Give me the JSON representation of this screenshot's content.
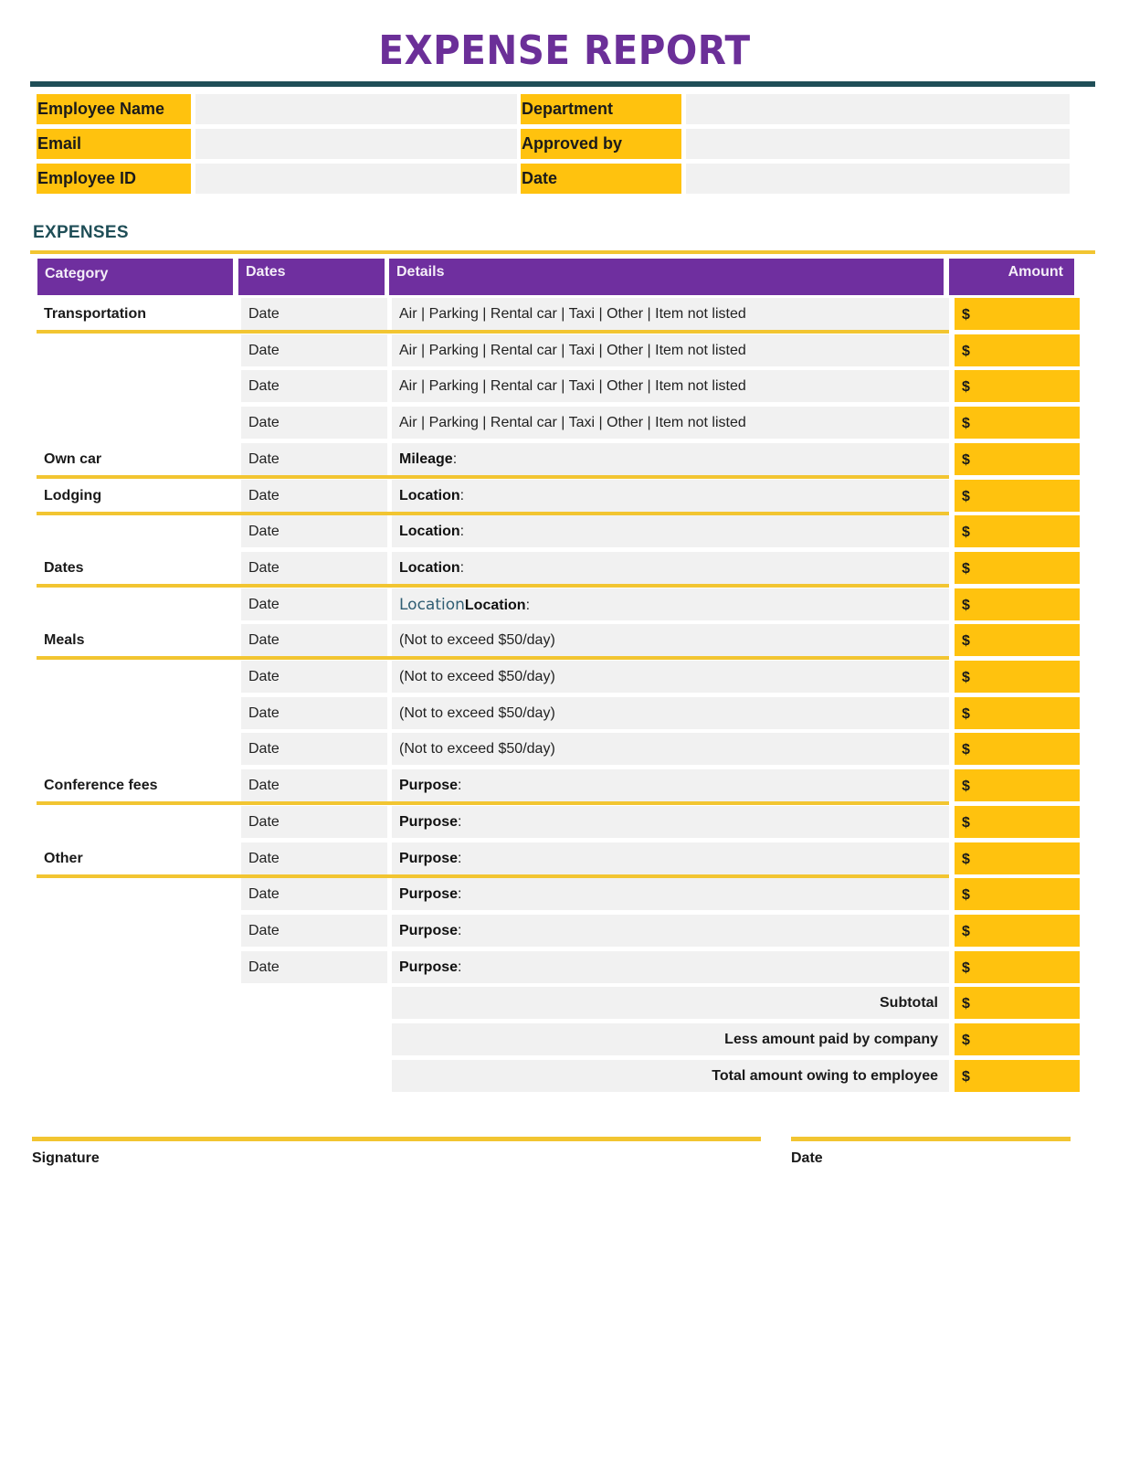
{
  "title": "EXPENSE REPORT",
  "info": {
    "left": [
      {
        "label": "Employee Name",
        "value": ""
      },
      {
        "label": "Email",
        "value": ""
      },
      {
        "label": "Employee ID",
        "value": ""
      }
    ],
    "right": [
      {
        "label": "Department",
        "value": ""
      },
      {
        "label": "Approved by",
        "value": ""
      },
      {
        "label": "Date",
        "value": ""
      }
    ]
  },
  "expenses": {
    "section_title": "EXPENSES",
    "headers": {
      "category": "Category",
      "dates": "Dates",
      "details": "Details",
      "amount": "Amount"
    },
    "currency_symbol": "$",
    "rows": [
      {
        "category": "Transportation",
        "date": "Date",
        "detail": "Air | Parking | Rental car | Taxi | Other | Item not listed",
        "detail_bold": "",
        "amount": ""
      },
      {
        "category": "",
        "date": "Date",
        "detail": "Air | Parking | Rental car | Taxi | Other | Item not listed",
        "detail_bold": "",
        "amount": ""
      },
      {
        "category": "",
        "date": "Date",
        "detail": "Air | Parking | Rental car | Taxi | Other | Item not listed",
        "detail_bold": "",
        "amount": ""
      },
      {
        "category": "",
        "date": "Date",
        "detail": "Air | Parking | Rental car | Taxi | Other | Item not listed",
        "detail_bold": "",
        "amount": ""
      },
      {
        "category": "Own car",
        "date": "Date",
        "detail_bold": "Mileage",
        "detail": ":",
        "amount": ""
      },
      {
        "category": "Lodging",
        "date": "Date",
        "detail_bold": "Location",
        "detail": ":",
        "amount": ""
      },
      {
        "category": "",
        "date": "Date",
        "detail_bold": "Location",
        "detail": ":",
        "amount": ""
      },
      {
        "category": "Dates",
        "date": "Date",
        "detail_bold": "Location",
        "detail": ":",
        "amount": ""
      },
      {
        "category": "",
        "date": "Date",
        "detail_prefix": "Location",
        "detail_bold": "Location",
        "detail": ":",
        "amount": ""
      },
      {
        "category": "Meals",
        "date": "Date",
        "detail": "(Not to exceed $50/day)",
        "detail_bold": "",
        "amount": ""
      },
      {
        "category": "",
        "date": "Date",
        "detail": "(Not to exceed $50/day)",
        "detail_bold": "",
        "amount": ""
      },
      {
        "category": "",
        "date": "Date",
        "detail": "(Not to exceed $50/day)",
        "detail_bold": "",
        "amount": ""
      },
      {
        "category": "",
        "date": "Date",
        "detail": "(Not to exceed $50/day)",
        "detail_bold": "",
        "amount": ""
      },
      {
        "category": "Conference fees",
        "date": "Date",
        "detail_bold": "Purpose",
        "detail": ":",
        "amount": ""
      },
      {
        "category": "",
        "date": "Date",
        "detail_bold": "Purpose",
        "detail": ":",
        "amount": ""
      },
      {
        "category": "Other",
        "date": "Date",
        "detail_bold": "Purpose",
        "detail": ":",
        "amount": ""
      },
      {
        "category": "",
        "date": "Date",
        "detail_bold": "Purpose",
        "detail": ":",
        "amount": ""
      },
      {
        "category": "",
        "date": "Date",
        "detail_bold": "Purpose",
        "detail": ":",
        "amount": ""
      },
      {
        "category": "",
        "date": "Date",
        "detail_bold": "Purpose",
        "detail": ":",
        "amount": ""
      }
    ],
    "separators_after_rows": [
      0,
      4,
      5,
      7,
      9,
      13,
      15
    ],
    "totals": [
      {
        "label": "Subtotal",
        "amount": ""
      },
      {
        "label": "Less amount paid by company",
        "amount": ""
      },
      {
        "label": "Total amount owing to employee",
        "amount": ""
      }
    ]
  },
  "signature": {
    "signature_label": "Signature",
    "date_label": "Date"
  },
  "colors": {
    "title": "#6b2f98",
    "header_bg": "#6f2f9f",
    "accent_yellow": "#ffc20e",
    "rule_teal": "#1f4e57",
    "field_gray": "#f1f1f1"
  }
}
